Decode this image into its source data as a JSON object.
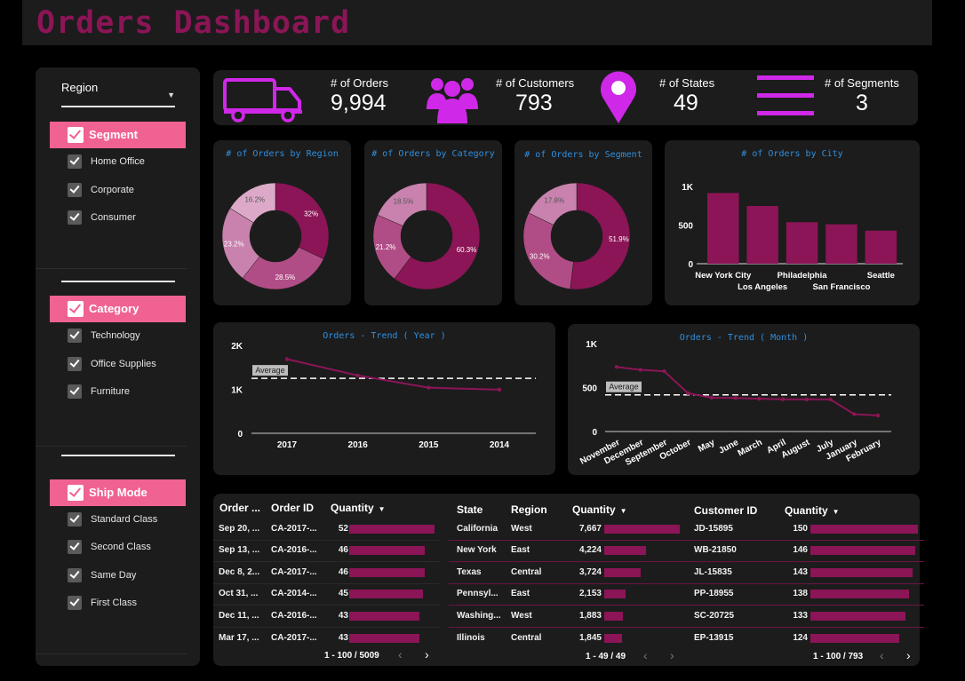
{
  "title": "Orders Dashboard",
  "filters": {
    "region_label": "Region",
    "sections": [
      {
        "label": "Segment",
        "options": [
          "Home Office",
          "Corporate",
          "Consumer"
        ]
      },
      {
        "label": "Category",
        "options": [
          "Technology",
          "Office Supplies",
          "Furniture"
        ]
      },
      {
        "label": "Ship Mode",
        "options": [
          "Standard Class",
          "Second Class",
          "Same Day",
          "First Class"
        ]
      }
    ]
  },
  "kpis": [
    {
      "label": "# of Orders",
      "value": "9,994",
      "icon": "truck-icon"
    },
    {
      "label": "# of Customers",
      "value": "793",
      "icon": "people-icon"
    },
    {
      "label": "# of States",
      "value": "49",
      "icon": "map-pin-icon"
    },
    {
      "label": "# of Segments",
      "value": "3",
      "icon": "menu-lines-icon"
    }
  ],
  "colors": {
    "accent": "#8b1556",
    "accent2": "#b14d86",
    "accent3": "#c882ad",
    "accent4": "#dcaac8",
    "pink": "#f06292",
    "title_blue": "#2f8fe0",
    "kpi_icon": "#d028e8"
  },
  "chart_data": [
    {
      "type": "pie",
      "title": "# of Orders by Region",
      "labels": [
        "32%",
        "28.5%",
        "23.2%",
        "16.2%"
      ],
      "values": [
        32,
        28.5,
        23.2,
        16.2
      ]
    },
    {
      "type": "pie",
      "title": "# of Orders by Category",
      "labels": [
        "60.3%",
        "21.2%",
        "18.5%"
      ],
      "values": [
        60.3,
        21.2,
        18.5
      ]
    },
    {
      "type": "pie",
      "title": "# of Orders by Segment",
      "labels": [
        "51.9%",
        "30.2%",
        "17.8%"
      ],
      "values": [
        51.9,
        30.2,
        17.8
      ]
    },
    {
      "type": "bar",
      "title": "# of Orders by City",
      "categories": [
        "New York City",
        "Los Angeles",
        "Philadelphia",
        "San Francisco",
        "Seattle"
      ],
      "values": [
        915,
        747,
        537,
        510,
        428
      ],
      "yticks": [
        "1K",
        "500",
        "0"
      ],
      "ylim": [
        0,
        1000
      ]
    },
    {
      "type": "line",
      "title": "Orders - Trend ( Year )",
      "categories": [
        "2017",
        "2016",
        "2015",
        "2014"
      ],
      "values": [
        1687,
        1315,
        1038,
        993
      ],
      "average": 1250,
      "average_label": "Average",
      "yticks": [
        "2K",
        "1K",
        "0"
      ],
      "ylim": [
        0,
        2000
      ]
    },
    {
      "type": "line",
      "title": "Orders - Trend ( Month )",
      "categories": [
        "November",
        "December",
        "September",
        "October",
        "May",
        "June",
        "March",
        "April",
        "August",
        "July",
        "January",
        "February"
      ],
      "values": [
        734,
        702,
        686,
        436,
        384,
        381,
        373,
        367,
        366,
        365,
        197,
        183
      ],
      "average": 417,
      "average_label": "Average",
      "yticks": [
        "1K",
        "500",
        "0"
      ],
      "ylim": [
        0,
        1000
      ]
    }
  ],
  "tables": [
    {
      "headers": [
        "Order ...",
        "Order ID",
        "Quantity"
      ],
      "rows": [
        [
          "Sep 20, ...",
          "CA-2017-...",
          "52"
        ],
        [
          "Sep 13, ...",
          "CA-2016-...",
          "46"
        ],
        [
          "Dec 8, 2...",
          "CA-2017-...",
          "46"
        ],
        [
          "Oct 31, ...",
          "CA-2014-...",
          "45"
        ],
        [
          "Dec 11, ...",
          "CA-2016-...",
          "43"
        ],
        [
          "Mar 17, ...",
          "CA-2017-...",
          "43"
        ]
      ],
      "values": [
        52,
        46,
        46,
        45,
        43,
        43
      ],
      "max": 52,
      "pager": "1 - 100 / 5009"
    },
    {
      "headers": [
        "State",
        "Region",
        "Quantity"
      ],
      "rows": [
        [
          "California",
          "West",
          "7,667"
        ],
        [
          "New York",
          "East",
          "4,224"
        ],
        [
          "Texas",
          "Central",
          "3,724"
        ],
        [
          "Pennsyl...",
          "East",
          "2,153"
        ],
        [
          "Washing...",
          "West",
          "1,883"
        ],
        [
          "Illinois",
          "Central",
          "1,845"
        ]
      ],
      "values": [
        7667,
        4224,
        3724,
        2153,
        1883,
        1845
      ],
      "max": 7667,
      "pager": "1 - 49 / 49"
    },
    {
      "headers": [
        "Customer ID",
        "Quantity"
      ],
      "rows": [
        [
          "JD-15895",
          "150"
        ],
        [
          "WB-21850",
          "146"
        ],
        [
          "JL-15835",
          "143"
        ],
        [
          "PP-18955",
          "138"
        ],
        [
          "SC-20725",
          "133"
        ],
        [
          "EP-13915",
          "124"
        ]
      ],
      "values": [
        150,
        146,
        143,
        138,
        133,
        124
      ],
      "max": 150,
      "pager": "1 - 100 / 793"
    }
  ]
}
